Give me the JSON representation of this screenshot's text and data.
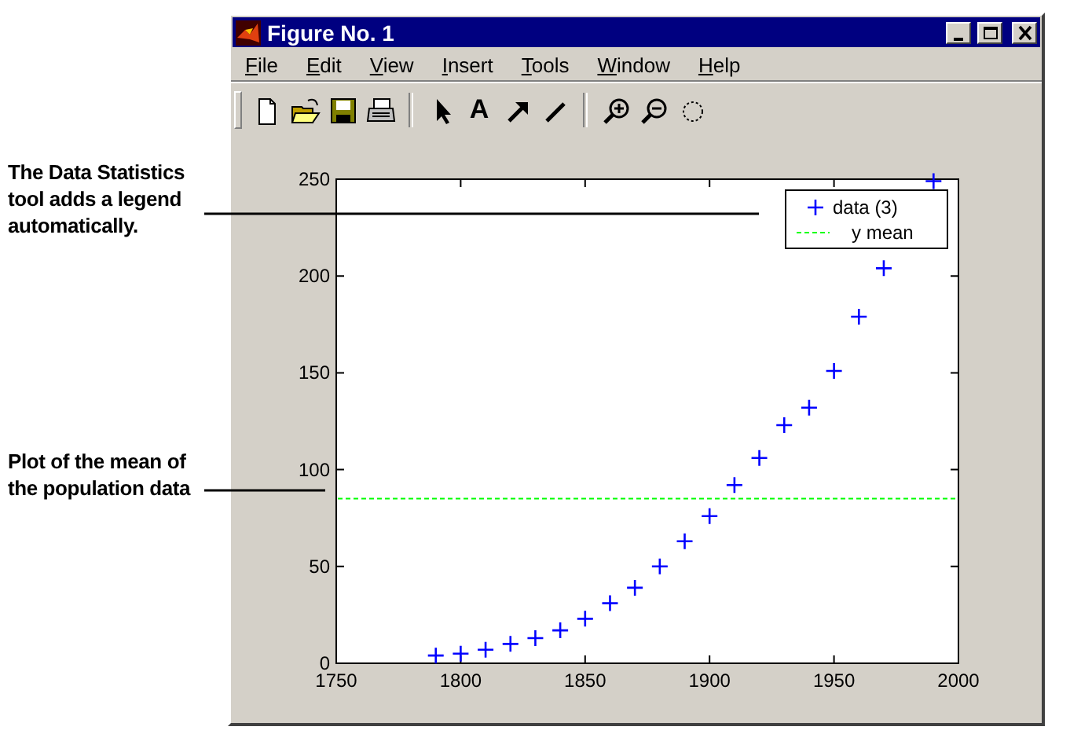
{
  "notes": [
    {
      "text": "The Data Statistics tool adds a legend automatically."
    },
    {
      "text": "Plot of the mean of the population data"
    }
  ],
  "window": {
    "title": "Figure No. 1"
  },
  "menu": [
    "File",
    "Edit",
    "View",
    "Insert",
    "Tools",
    "Window",
    "Help"
  ],
  "toolbar": {
    "text_tool_label": "A"
  },
  "chart_data": {
    "type": "scatter",
    "x": [
      1790,
      1800,
      1810,
      1820,
      1830,
      1840,
      1850,
      1860,
      1870,
      1880,
      1890,
      1900,
      1910,
      1920,
      1930,
      1940,
      1950,
      1960,
      1970,
      1990
    ],
    "series": [
      {
        "name": "data (3)",
        "color": "#0000ff",
        "values": [
          4,
          5,
          7,
          10,
          13,
          17,
          23,
          31,
          39,
          50,
          63,
          76,
          92,
          106,
          123,
          132,
          151,
          179,
          204,
          249
        ]
      }
    ],
    "xlim": [
      1750,
      2000
    ],
    "ylim": [
      0,
      250
    ],
    "xticks": [
      1750,
      1800,
      1850,
      1900,
      1950,
      2000
    ],
    "yticks": [
      0,
      50,
      100,
      150,
      200,
      250
    ],
    "legend": "upper right",
    "ref_lines": [
      {
        "axis": "y",
        "value": 85,
        "label": "y mean",
        "color": "#00ff00"
      }
    ]
  }
}
